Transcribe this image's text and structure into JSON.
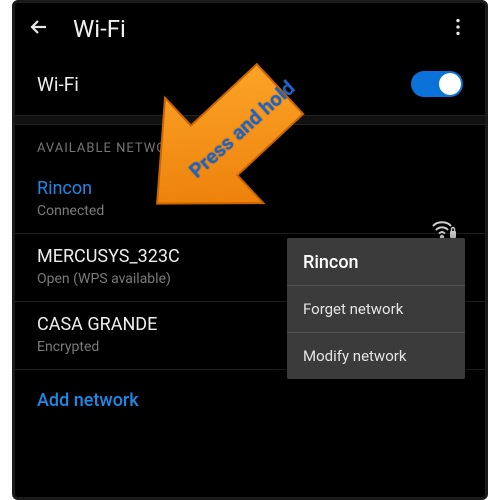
{
  "header": {
    "title": "Wi-Fi"
  },
  "wifi_row": {
    "label": "Wi-Fi",
    "enabled": true
  },
  "section": {
    "header": "AVAILABLE NETWORKS"
  },
  "networks": [
    {
      "name": "Rincon",
      "sub": "Connected",
      "accent": true
    },
    {
      "name": "MERCUSYS_323C",
      "sub": "Open (WPS available)",
      "accent": false
    },
    {
      "name": "CASA GRANDE",
      "sub": "Encrypted",
      "accent": false
    }
  ],
  "add_network": "Add network",
  "popup": {
    "title": "Rincon",
    "items": [
      "Forget network",
      "Modify network"
    ]
  },
  "annotation": {
    "text": "Press and hold"
  },
  "colors": {
    "accent": "#1e88e5",
    "toggle": "#0a72d8",
    "arrow": "#f38b00"
  }
}
